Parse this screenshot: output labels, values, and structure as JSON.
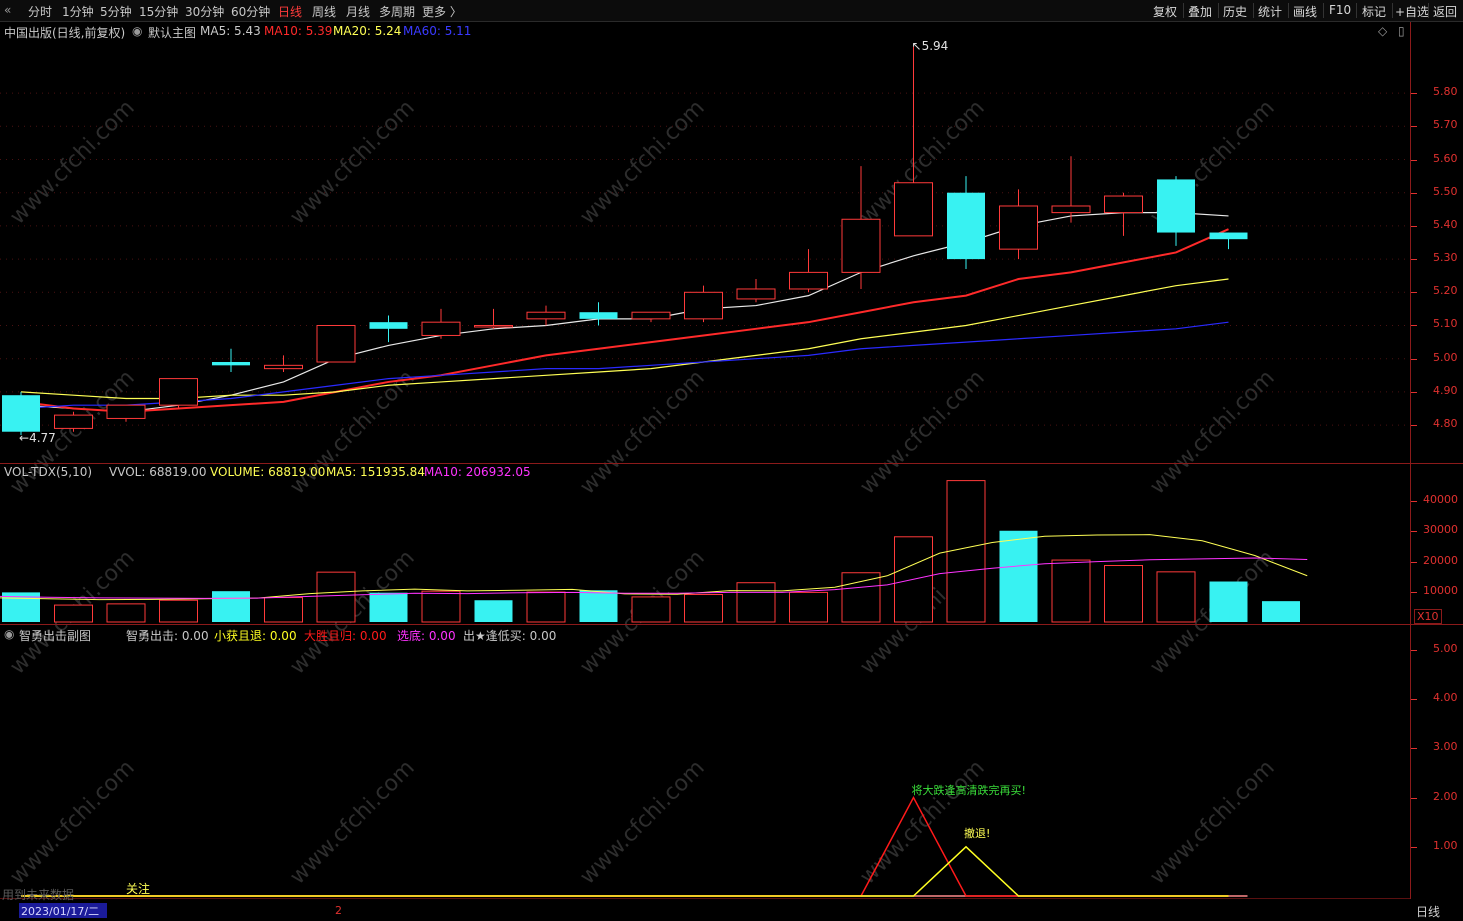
{
  "toolbar": {
    "back_glyph": "«",
    "periods": [
      "分时",
      "1分钟",
      "5分钟",
      "15分钟",
      "30分钟",
      "60分钟",
      "日线",
      "周线",
      "月线",
      "多周期",
      "更多 〉"
    ],
    "active_period": "日线",
    "right_buttons": [
      "复权",
      "叠加",
      "历史",
      "统计",
      "画线",
      "F10",
      "标记",
      "+自选",
      "返回"
    ]
  },
  "main_panel": {
    "stock_title": "中国出版(日线,前复权)",
    "dropdown_glyph": "◉",
    "template_label": "默认主图",
    "ma_legend": [
      {
        "label": "MA5: 5.43",
        "color": "#e8e8e8"
      },
      {
        "label": "MA10: 5.39",
        "color": "#ff2a2a"
      },
      {
        "label": "MA20: 5.24",
        "color": "#ffff55"
      },
      {
        "label": "MA60: 5.11",
        "color": "#2a2aff"
      }
    ],
    "max_price_label": "5.94",
    "min_price_label": "4.77",
    "y_axis": [
      "5.80",
      "5.70",
      "5.60",
      "5.50",
      "5.40",
      "5.30",
      "5.20",
      "5.10",
      "5.00",
      "4.90",
      "4.80"
    ],
    "corner_icons": [
      "◇",
      "▯"
    ]
  },
  "chart_data": [
    {
      "type": "candlestick",
      "title": "中国出版(日线,前复权)",
      "ylim": [
        4.74,
        5.96
      ],
      "candles": [
        {
          "o": 4.89,
          "h": 4.9,
          "l": 4.77,
          "c": 4.78
        },
        {
          "o": 4.79,
          "h": 4.84,
          "l": 4.78,
          "c": 4.83
        },
        {
          "o": 4.82,
          "h": 4.86,
          "l": 4.81,
          "c": 4.86
        },
        {
          "o": 4.86,
          "h": 4.94,
          "l": 4.85,
          "c": 4.94
        },
        {
          "o": 4.99,
          "h": 5.03,
          "l": 4.96,
          "c": 4.98
        },
        {
          "o": 4.97,
          "h": 5.01,
          "l": 4.96,
          "c": 4.98
        },
        {
          "o": 4.99,
          "h": 5.1,
          "l": 4.99,
          "c": 5.1
        },
        {
          "o": 5.11,
          "h": 5.13,
          "l": 5.05,
          "c": 5.09
        },
        {
          "o": 5.07,
          "h": 5.15,
          "l": 5.06,
          "c": 5.11
        },
        {
          "o": 5.1,
          "h": 5.15,
          "l": 5.09,
          "c": 5.1
        },
        {
          "o": 5.12,
          "h": 5.16,
          "l": 5.1,
          "c": 5.14
        },
        {
          "o": 5.14,
          "h": 5.17,
          "l": 5.1,
          "c": 5.12
        },
        {
          "o": 5.12,
          "h": 5.14,
          "l": 5.11,
          "c": 5.14
        },
        {
          "o": 5.12,
          "h": 5.22,
          "l": 5.11,
          "c": 5.2
        },
        {
          "o": 5.18,
          "h": 5.24,
          "l": 5.17,
          "c": 5.21
        },
        {
          "o": 5.21,
          "h": 5.33,
          "l": 5.2,
          "c": 5.26
        },
        {
          "o": 5.26,
          "h": 5.58,
          "l": 5.21,
          "c": 5.42
        },
        {
          "o": 5.37,
          "h": 5.94,
          "l": 5.37,
          "c": 5.53
        },
        {
          "o": 5.5,
          "h": 5.55,
          "l": 5.27,
          "c": 5.3
        },
        {
          "o": 5.33,
          "h": 5.51,
          "l": 5.3,
          "c": 5.46
        },
        {
          "o": 5.44,
          "h": 5.61,
          "l": 5.41,
          "c": 5.46
        },
        {
          "o": 5.44,
          "h": 5.5,
          "l": 5.37,
          "c": 5.49
        },
        {
          "o": 5.54,
          "h": 5.55,
          "l": 5.34,
          "c": 5.38
        },
        {
          "o": 5.38,
          "h": 5.38,
          "l": 5.33,
          "c": 5.36
        }
      ],
      "series": [
        {
          "name": "MA5",
          "color": "#e8e8e8",
          "values": [
            4.86,
            4.85,
            4.84,
            4.86,
            4.89,
            4.93,
            5.0,
            5.04,
            5.07,
            5.09,
            5.1,
            5.12,
            5.12,
            5.15,
            5.16,
            5.19,
            5.26,
            5.31,
            5.35,
            5.4,
            5.43,
            5.44,
            5.44,
            5.43
          ]
        },
        {
          "name": "MA10",
          "color": "#ff2a2a",
          "values": [
            4.87,
            4.85,
            4.84,
            4.85,
            4.86,
            4.87,
            4.9,
            4.93,
            4.95,
            4.98,
            5.01,
            5.03,
            5.05,
            5.07,
            5.09,
            5.11,
            5.14,
            5.17,
            5.19,
            5.24,
            5.26,
            5.29,
            5.32,
            5.39
          ]
        },
        {
          "name": "MA20",
          "color": "#ffff55",
          "values": [
            4.9,
            4.89,
            4.88,
            4.88,
            4.89,
            4.89,
            4.9,
            4.92,
            4.93,
            4.94,
            4.95,
            4.96,
            4.97,
            4.99,
            5.01,
            5.03,
            5.06,
            5.08,
            5.1,
            5.13,
            5.16,
            5.19,
            5.22,
            5.24
          ]
        },
        {
          "name": "MA60",
          "color": "#2a2aff",
          "values": [
            4.85,
            4.86,
            4.86,
            4.87,
            4.88,
            4.9,
            4.92,
            4.94,
            4.95,
            4.96,
            4.97,
            4.97,
            4.98,
            4.99,
            5.0,
            5.01,
            5.03,
            5.04,
            5.05,
            5.06,
            5.07,
            5.08,
            5.09,
            5.11
          ]
        }
      ]
    },
    {
      "type": "bar",
      "title": "VOL-TDX(5,10)",
      "ylim": [
        0,
        47000
      ],
      "values": [
        9800,
        5600,
        6000,
        7200,
        10200,
        8100,
        16500,
        9700,
        10200,
        7200,
        9900,
        10500,
        8300,
        9100,
        13000,
        9800,
        16300,
        28200,
        46800,
        30200,
        20500,
        18700,
        16600,
        13400,
        6900
      ],
      "up": [
        false,
        true,
        true,
        true,
        false,
        true,
        true,
        false,
        true,
        false,
        true,
        false,
        true,
        true,
        true,
        true,
        true,
        true,
        true,
        false,
        true,
        true,
        true,
        false,
        false
      ],
      "series": [
        {
          "name": "MA5",
          "color": "#ffff55",
          "values": [
            8000,
            7700,
            7400,
            7500,
            7700,
            7900,
            9400,
            10300,
            10900,
            10300,
            10500,
            10800,
            9300,
            9200,
            10400,
            10300,
            11500,
            15300,
            22800,
            26300,
            28400,
            28800,
            28900,
            26900,
            22000,
            15300
          ]
        },
        {
          "name": "MA10",
          "color": "#ff33ff",
          "values": [
            8500,
            8200,
            8000,
            7900,
            7800,
            7900,
            8500,
            9000,
            9500,
            9400,
            9700,
            9800,
            9500,
            9500,
            9800,
            9800,
            10700,
            12300,
            16000,
            17800,
            19300,
            20000,
            20600,
            20900,
            21200,
            20700
          ]
        }
      ]
    },
    {
      "type": "line",
      "title": "智勇出击副图",
      "ylim": [
        0,
        5.2
      ],
      "series": [
        {
          "name": "大胜且归",
          "color": "#ff1a1a",
          "values": [
            0,
            0,
            0,
            0,
            0,
            0,
            0,
            0,
            0,
            0,
            0,
            0,
            0,
            0,
            0,
            0,
            0,
            2,
            0,
            0,
            0,
            0,
            0,
            0
          ]
        },
        {
          "name": "小获且退",
          "color": "#ffff22",
          "values": [
            0,
            0,
            0,
            0,
            0,
            0,
            0,
            0,
            0,
            0,
            0,
            0,
            0,
            0,
            0,
            0,
            0,
            0,
            1,
            0,
            0,
            0,
            0,
            0
          ]
        }
      ]
    }
  ],
  "vol_panel": {
    "legend": [
      {
        "label": "VOL-TDX(5,10)",
        "color": "#d0d0d0"
      },
      {
        "label": "VVOL: 68819.00",
        "color": "#d0d0d0"
      },
      {
        "label": "VOLUME: 68819.00",
        "color": "#ffff55"
      },
      {
        "label": "MA5: 151935.84",
        "color": "#ffff55"
      },
      {
        "label": "MA10: 206932.05",
        "color": "#ff33ff"
      }
    ],
    "y_axis": [
      "40000",
      "30000",
      "20000",
      "10000"
    ],
    "unit_label": "X10"
  },
  "sub_panel": {
    "legend": [
      {
        "label": "智勇出击副图",
        "color": "#d0d0d0"
      },
      {
        "label": "智勇出击: 0.00",
        "color": "#d0d0d0"
      },
      {
        "label": "小获且退: 0.00",
        "color": "#ffff22"
      },
      {
        "label": "大胜且归: 0.00",
        "color": "#ff1a1a"
      },
      {
        "label": "选底: 0.00",
        "color": "#ff33ff"
      },
      {
        "label": "出★逢低买: 0.00",
        "color": "#d0d0d0"
      }
    ],
    "y_axis": [
      "5.00",
      "4.00",
      "3.00",
      "2.00",
      "1.00"
    ],
    "annotation_red": "将大跌逢高清跌完再买!",
    "annotation_yellow": "撤退!",
    "watch_label": "关注",
    "future_data_label": "用到未来数据"
  },
  "bottom_bar": {
    "date": "2023/01/17/二",
    "marker": "2",
    "period_button": "日线"
  },
  "watermark": "www.cfchi.com"
}
